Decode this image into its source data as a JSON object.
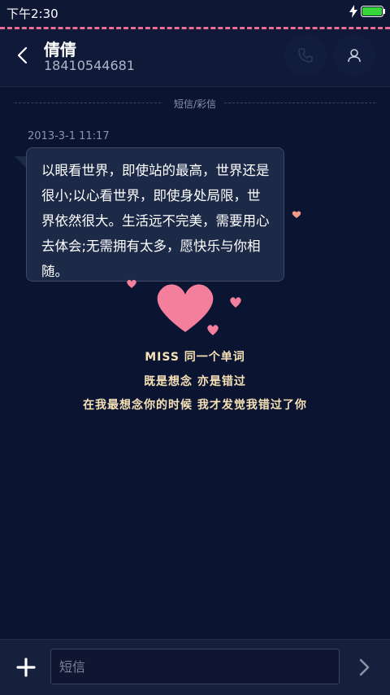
{
  "status_bar": {
    "time": "下午2:30"
  },
  "header": {
    "contact_name": "倩倩",
    "contact_number": "18410544681"
  },
  "divider_label": "短信/彩信",
  "message": {
    "timestamp": "2013-3-1 11:17",
    "text": "以眼看世界，即使站的最高，世界还是很小;以心看世界，即使身处局限，世界依然很大。生活远不完美，需要用心去体会;无需拥有太多，愿快乐与你相随。"
  },
  "art": {
    "line1": "MISS 同一个单词",
    "line2": "既是想念 亦是错过",
    "line3": "在我最想念你的时候 我才发觉我错过了你"
  },
  "compose": {
    "placeholder": "短信"
  },
  "colors": {
    "background": "#0b1430",
    "accent_pink": "#e86f95",
    "heart": "#f47f9d"
  }
}
